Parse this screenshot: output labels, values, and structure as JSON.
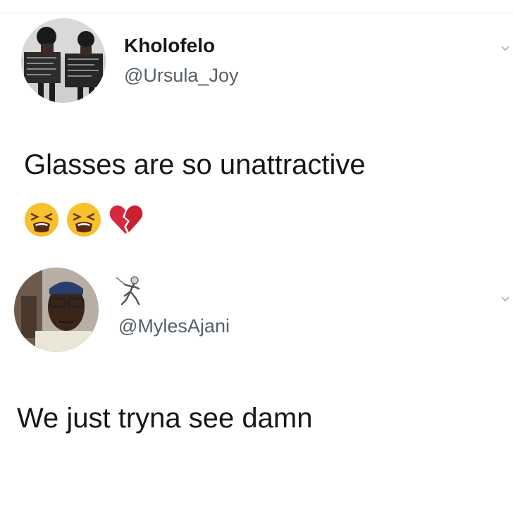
{
  "tweet1": {
    "display_name": "Kholofelo",
    "handle": "@Ursula_Joy",
    "text": "Glasses are so unattractive",
    "emojis": [
      "tired-face-emoji",
      "tired-face-emoji",
      "broken-heart-emoji"
    ]
  },
  "tweet2": {
    "name_emoji": "fencer-emoji",
    "handle": "@MylesAjani",
    "text": "We just tryna see damn"
  },
  "colors": {
    "text": "#14171a",
    "handle": "#555f67",
    "divider": "#e6ecf0",
    "emoji_yellow": "#f7c02c",
    "broken_heart": "#d8283f"
  }
}
